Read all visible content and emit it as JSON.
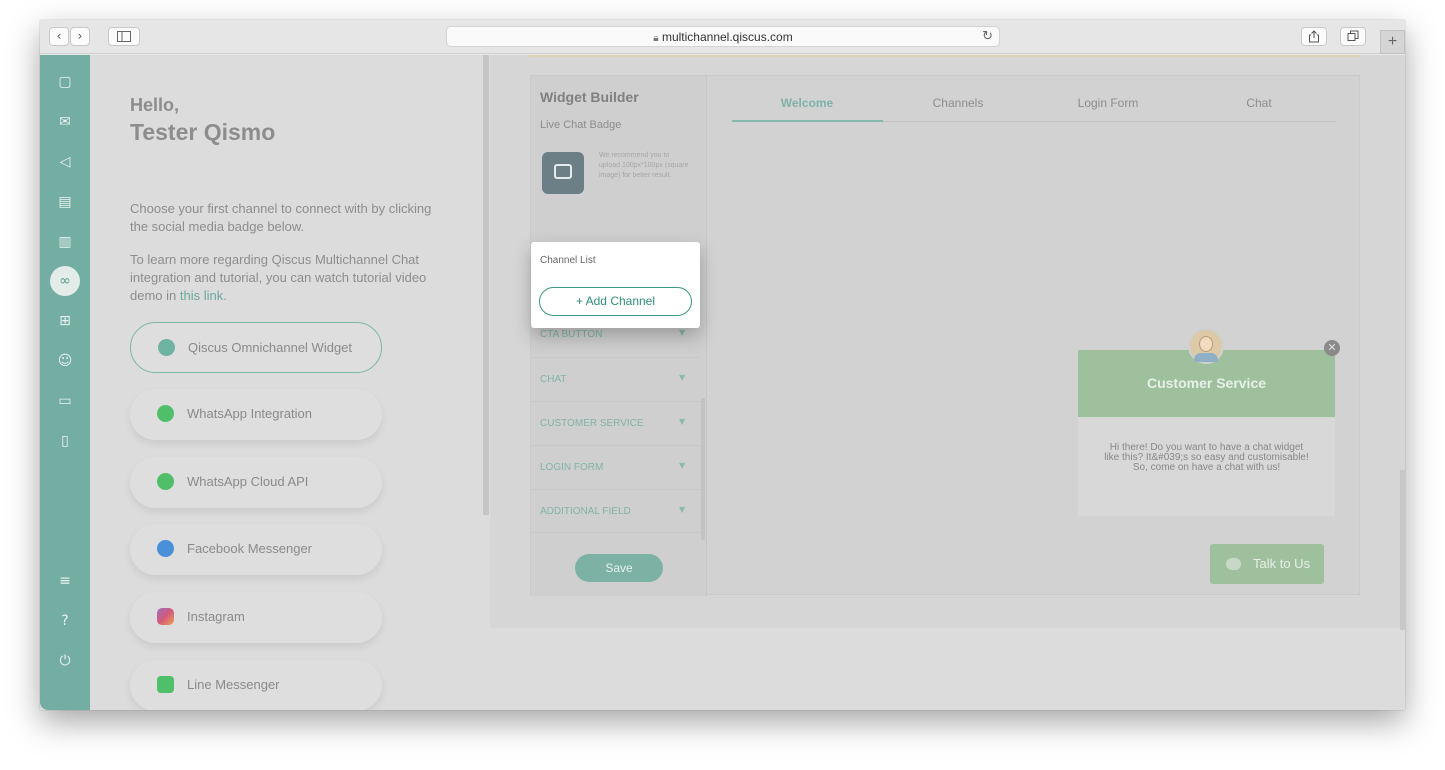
{
  "browser": {
    "url": "multichannel.qiscus.com",
    "back_glyph": "‹",
    "forward_glyph": "›",
    "reload_glyph": "↻",
    "new_tab_glyph": "+"
  },
  "sidebar": {
    "items": [
      {
        "icon": "chat-bubble-icon",
        "glyph": "▢"
      },
      {
        "icon": "mail-icon",
        "glyph": "✉"
      },
      {
        "icon": "megaphone-icon",
        "glyph": "◁"
      },
      {
        "icon": "id-card-icon",
        "glyph": "▤"
      },
      {
        "icon": "analytics-icon",
        "glyph": "▥"
      },
      {
        "icon": "integration-icon",
        "glyph": "∞"
      },
      {
        "icon": "apps-grid-icon",
        "glyph": "⊞"
      },
      {
        "icon": "user-icon",
        "glyph": "☺"
      },
      {
        "icon": "ticket-icon",
        "glyph": "▭"
      },
      {
        "icon": "mobile-icon",
        "glyph": "▯"
      },
      {
        "icon": "settings-sliders-icon",
        "glyph": "≡"
      },
      {
        "icon": "help-icon",
        "glyph": "?"
      },
      {
        "icon": "power-icon",
        "glyph": "⏻"
      }
    ],
    "accent_color": "#74aea2"
  },
  "greeting": {
    "hello": "Hello,",
    "name": "Tester Qismo",
    "intro": "Choose your first channel to connect with by clicking the social media badge below.",
    "learn_more_prefix": "To learn more regarding Qiscus Multichannel Chat integration and tutorial, you can watch tutorial video demo in ",
    "link_text": "this link",
    "learn_more_suffix": "."
  },
  "channels": [
    {
      "label": "Qiscus Omnichannel Widget",
      "icon": "qiscus-icon",
      "color": "#6fb3a2",
      "selected": true
    },
    {
      "label": "WhatsApp Integration",
      "icon": "whatsapp-icon",
      "color": "#4fbf6a",
      "selected": false
    },
    {
      "label": "WhatsApp Cloud API",
      "icon": "whatsapp-icon",
      "color": "#4fbf6a",
      "selected": false
    },
    {
      "label": "Facebook Messenger",
      "icon": "messenger-icon",
      "color": "#4a90d9",
      "selected": false
    },
    {
      "label": "Instagram",
      "icon": "instagram-icon",
      "color": "#c7588a",
      "selected": false
    },
    {
      "label": "Line Messenger",
      "icon": "line-icon",
      "color": "#4fbf6a",
      "selected": false
    }
  ],
  "widget_builder": {
    "title": "Widget Builder",
    "live_chat_badge": "Live Chat Badge",
    "recommend_text": "We recommend you to upload 100px*100px (square image) for better result.",
    "sections": [
      "CTA BUTTON",
      "CHAT",
      "CUSTOMER SERVICE",
      "LOGIN FORM",
      "ADDITIONAL FIELD"
    ],
    "caret_glyph": "▼",
    "save_label": "Save"
  },
  "tabs": [
    {
      "label": "Welcome",
      "active": true
    },
    {
      "label": "Channels",
      "active": false
    },
    {
      "label": "Login Form",
      "active": false
    },
    {
      "label": "Chat",
      "active": false
    }
  ],
  "preview": {
    "title": "Customer Service",
    "message": "Hi there! Do you want to have a chat widget like this? It&#039;s so easy and customisable! So, come on have a chat with us!",
    "close_glyph": "✕",
    "talk_label": "Talk to Us",
    "header_color": "#9ec09c"
  },
  "popup": {
    "title": "Channel List",
    "add_label": "+ Add Channel",
    "accent_color": "#2e8f7b"
  }
}
